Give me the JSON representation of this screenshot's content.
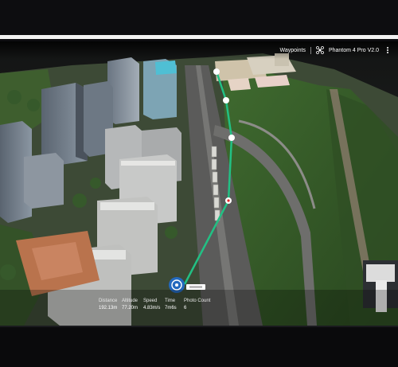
{
  "topbar": {
    "title": "Waypoints",
    "drone_model": "Phantom 4 Pro V2.0",
    "icons": [
      "drone-icon",
      "more-icon"
    ]
  },
  "stats": [
    {
      "label": "Distance",
      "value": "192.13m"
    },
    {
      "label": "Altitude",
      "value": "77.20m"
    },
    {
      "label": "Speed",
      "value": "4.83m/s"
    },
    {
      "label": "Time",
      "value": "7m6s"
    },
    {
      "label": "Photo Count",
      "value": "6"
    }
  ],
  "route": {
    "color": "#22c084",
    "waypoint_color": "#ffffff",
    "current_waypoint_color": "#e02424"
  }
}
